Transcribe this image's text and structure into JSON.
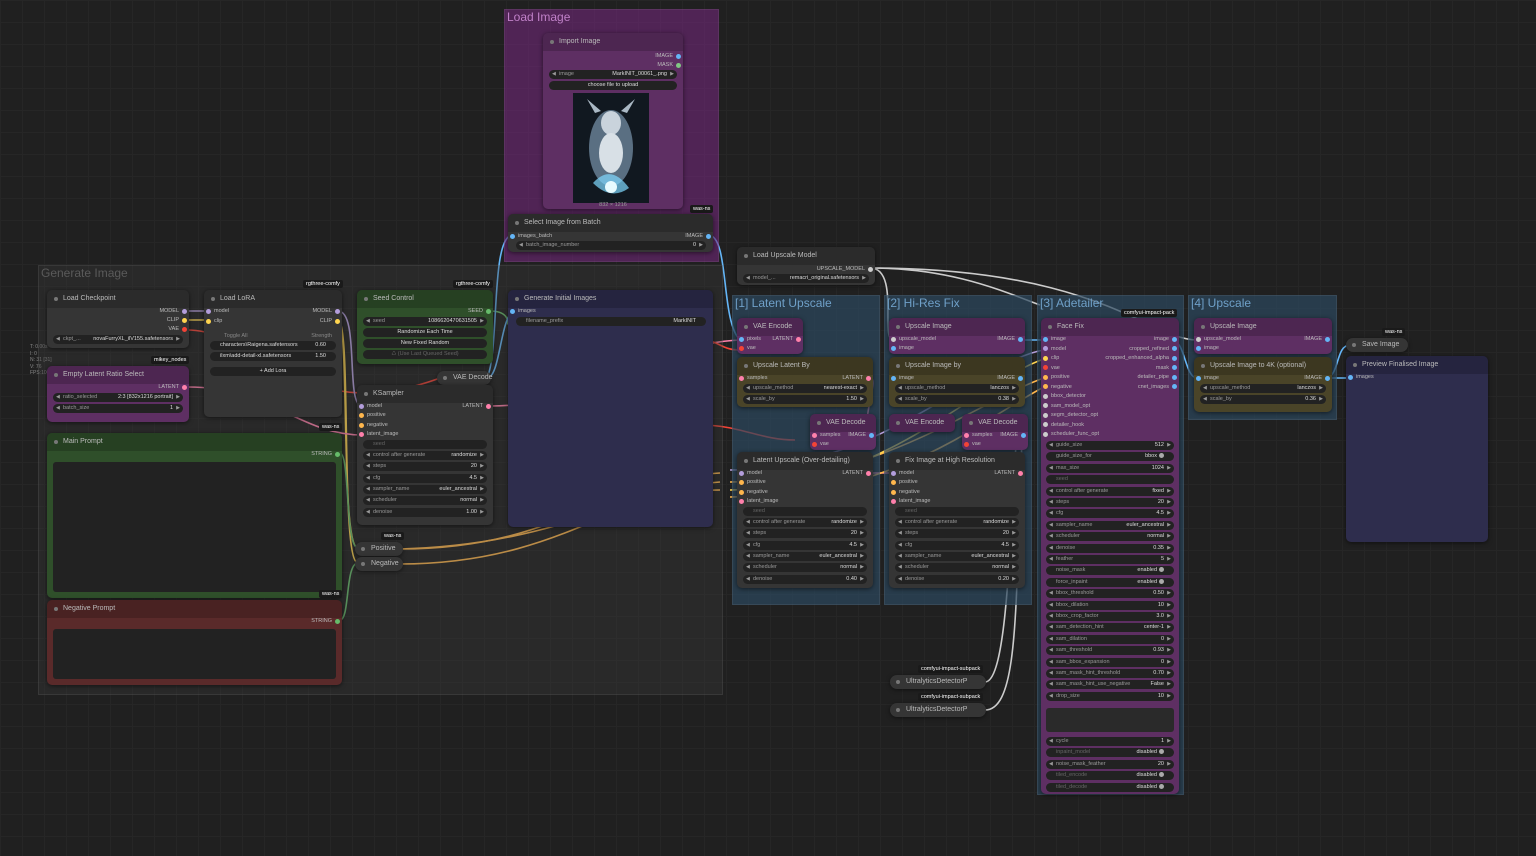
{
  "stats": {
    "t": "T: 0.00s",
    "i": "I: 0",
    "n": "N: 31 [31]",
    "v": "V: 76",
    "fps": "FPS:100"
  },
  "groups": {
    "load_image": "Load Image",
    "generate": "Generate Image",
    "latent_upscale": "[1] Latent Upscale",
    "hires": "[2] Hi-Res Fix",
    "adetailer": "[3] Adetailer",
    "upscale": "[4] Upscale"
  },
  "badges": {
    "rgthree1": "rgthree-comfy",
    "rgthree2": "rgthree-comfy",
    "mikey": "mikey_nodes",
    "wasns1": "was-ns",
    "wasns2": "was-ns",
    "wasns3": "was-ns",
    "wasns4": "was-ns",
    "wasns5": "was-ns",
    "impactpack": "comfyui-impact-pack",
    "subpack1": "comfyui-impact-subpack",
    "subpack2": "comfyui-impact-subpack"
  },
  "import_image": {
    "title": "Import Image",
    "out_image": "IMAGE",
    "out_mask": "MASK",
    "image_label": "image",
    "image_value": "MarkINIT_00061_.png",
    "upload": "choose file to upload",
    "size": "832 × 1216"
  },
  "select_batch": {
    "title": "Select Image from Batch",
    "in_images": "images_batch",
    "out": "IMAGE",
    "w_label": "batch_image_number",
    "w_value": "0"
  },
  "load_upscale_model": {
    "title": "Load Upscale Model",
    "out": "UPSCALE_MODEL",
    "w_label": "model_...",
    "w_value": "remacri_original.safetensors"
  },
  "load_checkpoint": {
    "title": "Load Checkpoint",
    "o1": "MODEL",
    "o2": "CLIP",
    "o3": "VAE",
    "w_label": "ckpt_...",
    "w_value": "novaFurryXL_ilV155.safetensors"
  },
  "load_lora": {
    "title": "Load LoRA",
    "i1": "model",
    "i2": "clip",
    "o1": "MODEL",
    "o2": "CLIP",
    "toggle": "Toggle All",
    "strength": "Strength",
    "l1": "characters\\Raigena.safetensors",
    "v1": "0.60",
    "l2": "ilxm\\add-detail-xl.safetensors",
    "v2": "1.50",
    "add": "+ Add Lora"
  },
  "seed_control": {
    "title": "Seed Control",
    "out": "SEED",
    "w_label": "seed",
    "w_value": "1086620470631505",
    "b1": "Randomize Each Time",
    "b2": "New Fixed Random",
    "b3": "♺ (Use Last Queued Seed)"
  },
  "empty_latent": {
    "title": "Empty Latent Ratio Select",
    "out": "LATENT",
    "w1_label": "ratio_selected",
    "w1_value": "2:3 [832x1216 portrait]",
    "w2_label": "batch_size",
    "w2_value": "1"
  },
  "main_prompt": {
    "title": "Main Prompt",
    "out": "STRING"
  },
  "negative_prompt": {
    "title": "Negative Prompt",
    "out": "STRING"
  },
  "vae_decode_main": {
    "title": "VAE Decode"
  },
  "ksampler": {
    "title": "KSampler",
    "i1": "model",
    "i2": "positive",
    "i3": "negative",
    "i4": "latent_image",
    "o1": "LATENT",
    "seed": "seed",
    "w1": "control after generate",
    "v1": "randomize",
    "w2": "steps",
    "v2": "20",
    "w3": "cfg",
    "v3": "4.5",
    "w4": "sampler_name",
    "v4": "euler_ancestral",
    "w5": "scheduler",
    "v5": "normal",
    "w6": "denoise",
    "v6": "1.00"
  },
  "positive_node": {
    "title": "Positive"
  },
  "negative_node": {
    "title": "Negative"
  },
  "generate_initial": {
    "title": "Generate Initial Images",
    "in": "images",
    "w_label": "filename_prefix",
    "w_value": "MarkINIT"
  },
  "vae_encode1": {
    "title": "VAE Encode",
    "i1": "pixels",
    "i2": "vae",
    "o1": "LATENT"
  },
  "upscale_latent_by": {
    "title": "Upscale Latent By",
    "i1": "samples",
    "o1": "LATENT",
    "w1": "upscale_method",
    "v1": "nearest-exact",
    "w2": "scale_by",
    "v2": "1.50"
  },
  "vae_decode1": {
    "title": "VAE Decode",
    "i1": "samples",
    "i2": "vae",
    "o1": "IMAGE"
  },
  "latent_upscale_ks": {
    "title": "Latent Upscale (Over-detailing)",
    "i1": "model",
    "i2": "positive",
    "i3": "negative",
    "i4": "latent_image",
    "o1": "LATENT",
    "seed": "seed",
    "w1": "control after generate",
    "v1": "randomize",
    "w2": "steps",
    "v2": "20",
    "w3": "cfg",
    "v3": "4.5",
    "w4": "sampler_name",
    "v4": "euler_ancestral",
    "w5": "scheduler",
    "v5": "normal",
    "w6": "denoise",
    "v6": "0.40"
  },
  "upscale_image1": {
    "title": "Upscale Image",
    "i1": "upscale_model",
    "i2": "image",
    "o1": "IMAGE"
  },
  "upscale_image_by": {
    "title": "Upscale Image by",
    "i1": "image",
    "o1": "IMAGE",
    "w1": "upscale_method",
    "v1": "lanczos",
    "w2": "scale_by",
    "v2": "0.38"
  },
  "vae_encode2": {
    "title": "VAE Encode"
  },
  "vae_decode2": {
    "title": "VAE Decode",
    "i1": "samples",
    "i2": "vae",
    "o1": "IMAGE"
  },
  "fix_image": {
    "title": "Fix Image at High Resolution",
    "i1": "model",
    "i2": "positive",
    "i3": "negative",
    "i4": "latent_image",
    "o1": "LATENT",
    "seed": "seed",
    "w1": "control after generate",
    "v1": "randomize",
    "w2": "steps",
    "v2": "20",
    "w3": "cfg",
    "v3": "4.5",
    "w4": "sampler_name",
    "v4": "euler_ancestral",
    "w5": "scheduler",
    "v5": "normal",
    "w6": "denoise",
    "v6": "0.20"
  },
  "face_fix": {
    "title": "Face Fix",
    "inputs": [
      "image",
      "model",
      "clip",
      "vae",
      "positive",
      "negative",
      "bbox_detector",
      "sam_model_opt",
      "segm_detector_opt",
      "detailer_hook",
      "scheduler_func_opt"
    ],
    "outputs": [
      "image",
      "cropped_refined",
      "cropped_enhanced_alpha",
      "mask",
      "detailer_pipe",
      "cnet_images"
    ],
    "widgets": [
      [
        "guide_size",
        "512"
      ],
      [
        "guide_size_for",
        "bbox"
      ],
      [
        "max_size",
        "1024"
      ],
      [
        "seed",
        ""
      ],
      [
        "control after generate",
        "fixed"
      ],
      [
        "steps",
        "20"
      ],
      [
        "cfg",
        "4.5"
      ],
      [
        "sampler_name",
        "euler_ancestral"
      ],
      [
        "scheduler",
        "normal"
      ],
      [
        "denoise",
        "0.35"
      ],
      [
        "feather",
        "5"
      ],
      [
        "noise_mask",
        "enabled"
      ],
      [
        "force_inpaint",
        "enabled"
      ],
      [
        "bbox_threshold",
        "0.50"
      ],
      [
        "bbox_dilation",
        "10"
      ],
      [
        "bbox_crop_factor",
        "3.0"
      ],
      [
        "sam_detection_hint",
        "center-1"
      ],
      [
        "sam_dilation",
        "0"
      ],
      [
        "sam_threshold",
        "0.93"
      ],
      [
        "sam_bbox_expansion",
        "0"
      ],
      [
        "sam_mask_hint_threshold",
        "0.70"
      ],
      [
        "sam_mask_hint_use_negative",
        "False"
      ],
      [
        "drop_size",
        "10"
      ]
    ],
    "widgets2": [
      [
        "cycle",
        "1"
      ],
      [
        "inpaint_model",
        "disabled"
      ],
      [
        "noise_mask_feather",
        "20"
      ],
      [
        "tiled_encode",
        "disabled"
      ],
      [
        "tiled_decode",
        "disabled"
      ]
    ]
  },
  "upscale_image2": {
    "title": "Upscale Image",
    "i1": "upscale_model",
    "i2": "image",
    "o1": "IMAGE"
  },
  "upscale_4k": {
    "title": "Upscale Image to 4K (optional)",
    "i1": "image",
    "o1": "IMAGE",
    "w1": "upscale_method",
    "v1": "lanczos",
    "w2": "scale_by",
    "v2": "0.36"
  },
  "save_image": {
    "title": "Save Image"
  },
  "preview": {
    "title": "Preview Finalised Image",
    "in": "images"
  },
  "ultra1": {
    "title": "UltralyticsDetectorP"
  },
  "ultra2": {
    "title": "UltralyticsDetectorP"
  },
  "colors": {
    "purple": "#5e2f63",
    "green": "#2f4f2a",
    "red": "#5a2a2a",
    "blue": "#2c3e50",
    "olive": "#4a4428",
    "indigo": "#2e2d4d"
  }
}
